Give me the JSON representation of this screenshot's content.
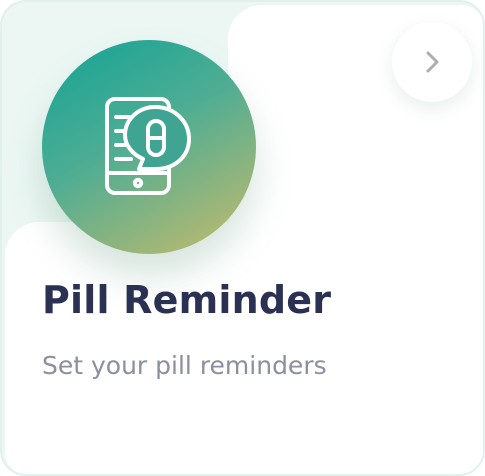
{
  "card": {
    "title": "Pill Reminder",
    "subtitle": "Set your pill reminders",
    "icon": "phone-pill-chat-icon",
    "action_icon": "chevron-right-icon"
  },
  "colors": {
    "gradient_start": "#12a396",
    "gradient_end": "#c8bb6a",
    "title": "#2b3153",
    "subtitle": "#8b8f9e",
    "background_tint": "#ecf7f4"
  }
}
